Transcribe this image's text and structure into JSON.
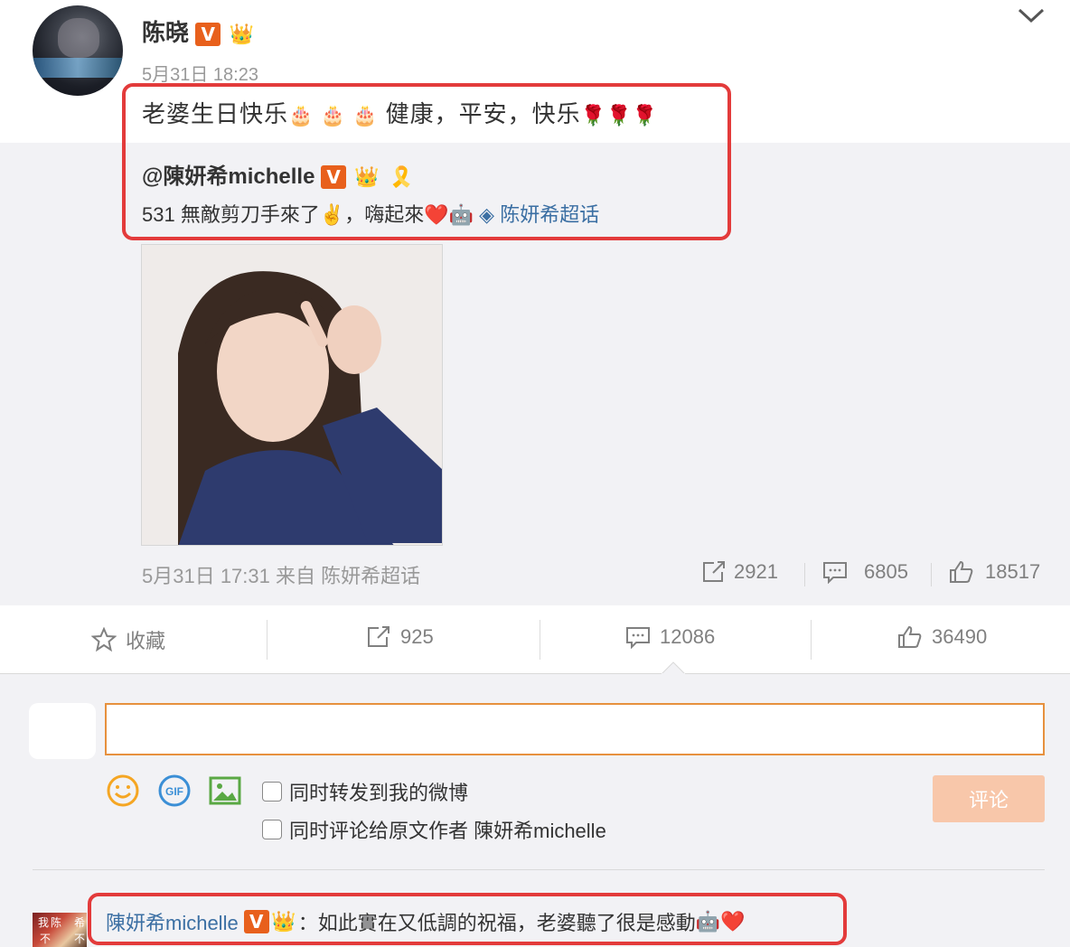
{
  "post": {
    "author": "陈晓",
    "badge_v": "V",
    "time": "5月31日 18:23",
    "text_main": "老婆生日快乐",
    "cakes": "🎂 🎂 🎂",
    "text_tail": " 健康，平安，快乐",
    "roses": "🌹🌹🌹",
    "collapse_icon": "chevron-down-icon"
  },
  "repost": {
    "author": "@陳妍希michelle",
    "badge_v": "V",
    "text": "531 無敵剪刀手來了✌️，嗨起來",
    "emoji_tail": "❤️",
    "topic": "陈妍希超话",
    "meta": "5月31日 17:31 来自 陈妍希超话",
    "stats": {
      "share": "2921",
      "comment": "6805",
      "like": "18517"
    }
  },
  "actions": {
    "favorite": "收藏",
    "share": "925",
    "comment": "12086",
    "like": "36490"
  },
  "comment_box": {
    "input_value": "",
    "option_repost": "同时转发到我的微博",
    "option_comment_original": "同时评论给原文作者 陳妍希michelle",
    "submit": "评论",
    "icons": [
      "emoji-icon",
      "gif-icon",
      "image-icon"
    ]
  },
  "comment": {
    "author": "陳妍希michelle",
    "badge_v": "V",
    "text": "：如此實在又低調的祝福，老婆聽了很是感動",
    "emoji_tail": "❤️"
  },
  "colors": {
    "accent_orange": "#e8601c",
    "highlight_red": "#e33b3b",
    "link_blue": "#3b6fa3",
    "submit_disabled": "#f8c7aa"
  }
}
